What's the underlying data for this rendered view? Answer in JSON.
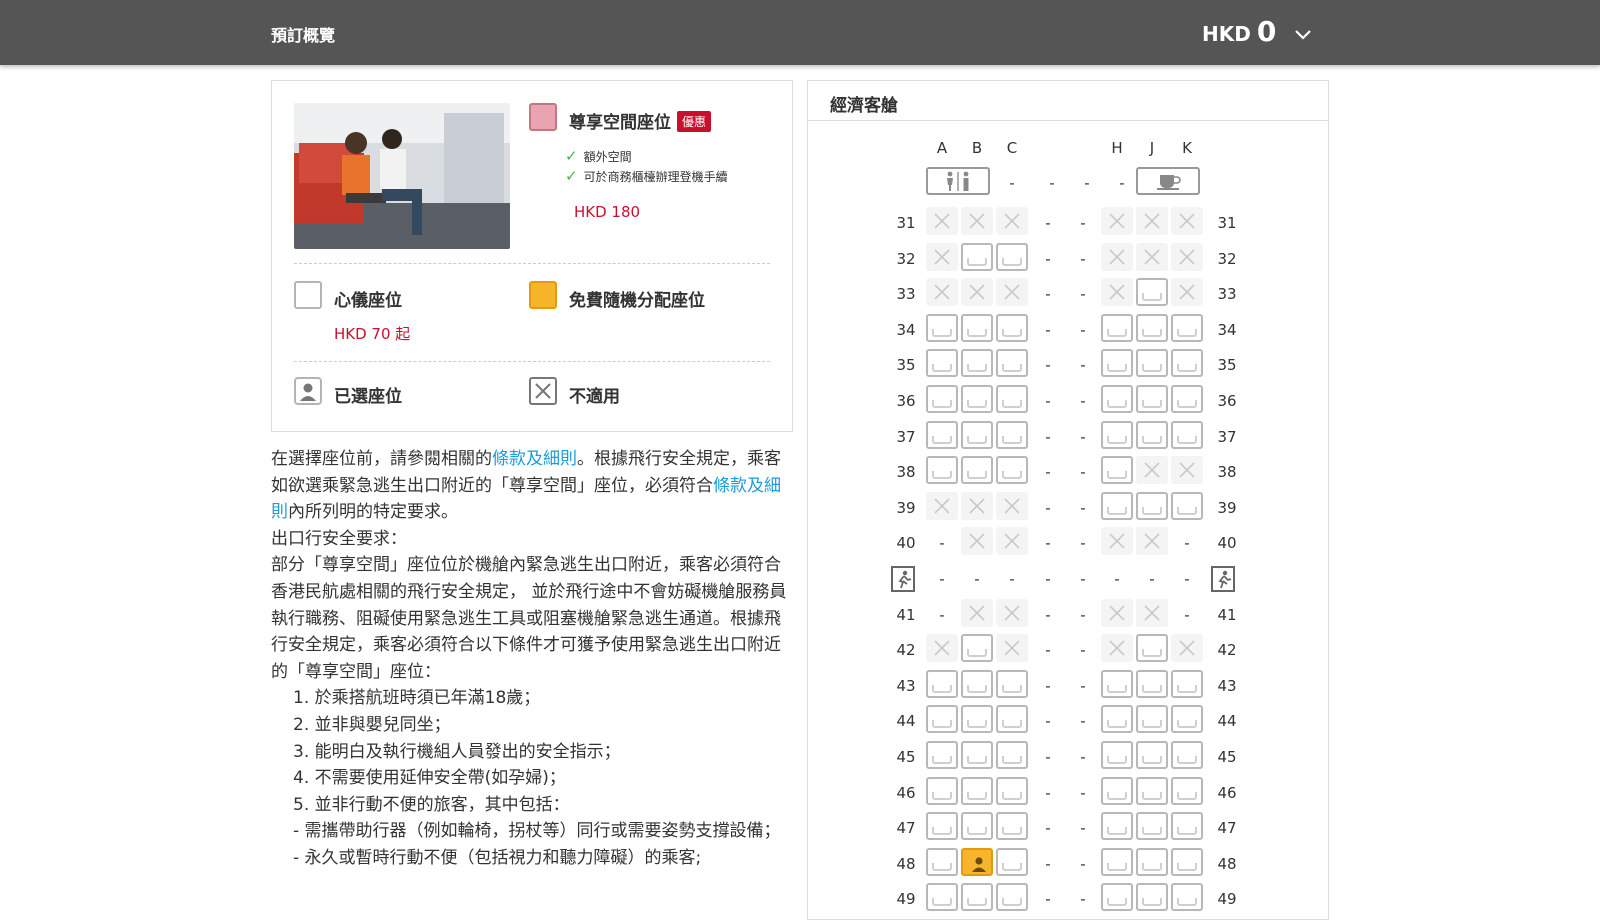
{
  "header": {
    "title": "預訂概覽",
    "currency": "HKD",
    "amount": "0"
  },
  "legend": {
    "premium": {
      "label": "尊享空間座位",
      "tag": "優惠",
      "features": [
        "額外空間",
        "可於商務櫃檯辦理登機手續"
      ],
      "price": "HKD 180"
    },
    "preferred": {
      "label": "心儀座位",
      "price": "HKD 70 起"
    },
    "free": {
      "label": "免費隨機分配座位"
    },
    "selected": {
      "label": "已選座位"
    },
    "unavailable": {
      "label": "不適用"
    }
  },
  "notice": {
    "p1_a": "在選擇座位前，請參閱相關的",
    "p1_link1": "條款及細則",
    "p1_b": "。根據飛行安全規定，乘客如欲選乘緊急逃生出口附近的「尊享空間」座位，必須符合",
    "p1_link2": "條款及細則",
    "p1_c": "內所列明的特定要求。",
    "heading": "出口行安全要求：",
    "p2": "部分「尊享空間」座位位於機艙內緊急逃生出口附近，乘客必須符合香港民航處相關的飛行安全規定， 並於飛行途中不會妨礙機艙服務員執行職務、阻礙使用緊急逃生工具或阻塞機艙緊急逃生通道。根據飛行安全規定，乘客必須符合以下條件才可獲予使用緊急逃生出口附近的「尊享空間」座位：",
    "items": [
      "1. 於乘搭航班時須已年滿18歲；",
      "2. 並非與嬰兒同坐；",
      "3. 能明白及執行機組人員發出的安全指示；",
      "4. 不需要使用延伸安全帶(如孕婦)；",
      "5. 並非行動不便的旅客，其中包括：",
      "- 需攜帶助行器（例如輪椅，拐杖等）同行或需要姿勢支撐設備；",
      "- 永久或暫時行動不便（包括視力和聽力障礙）的乘客;"
    ]
  },
  "cabin": {
    "title": "經濟客艙",
    "columns": [
      "A",
      "B",
      "C",
      "H",
      "J",
      "K"
    ],
    "aisle_mark": "-",
    "facilities": [
      "lavatory-icon",
      "galley-icon"
    ],
    "rows": [
      {
        "n": "31",
        "s": [
          "x",
          "x",
          "x",
          "x",
          "x",
          "x"
        ]
      },
      {
        "n": "32",
        "s": [
          "x",
          "o",
          "o",
          "x",
          "x",
          "x"
        ]
      },
      {
        "n": "33",
        "s": [
          "x",
          "x",
          "x",
          "x",
          "o",
          "x"
        ]
      },
      {
        "n": "34",
        "s": [
          "o",
          "o",
          "o",
          "o",
          "o",
          "o"
        ]
      },
      {
        "n": "35",
        "s": [
          "o",
          "o",
          "o",
          "o",
          "o",
          "o"
        ]
      },
      {
        "n": "36",
        "s": [
          "o",
          "o",
          "o",
          "o",
          "o",
          "o"
        ]
      },
      {
        "n": "37",
        "s": [
          "o",
          "o",
          "o",
          "o",
          "o",
          "o"
        ]
      },
      {
        "n": "38",
        "s": [
          "o",
          "o",
          "o",
          "o",
          "x",
          "x"
        ]
      },
      {
        "n": "39",
        "s": [
          "x",
          "x",
          "x",
          "o",
          "o",
          "o"
        ]
      },
      {
        "n": "40",
        "s": [
          "-",
          "x",
          "x",
          "x",
          "x",
          "-"
        ]
      },
      {
        "n": "exit"
      },
      {
        "n": "41",
        "s": [
          "-",
          "x",
          "x",
          "x",
          "x",
          "-"
        ]
      },
      {
        "n": "42",
        "s": [
          "x",
          "o",
          "x",
          "x",
          "o",
          "x"
        ]
      },
      {
        "n": "43",
        "s": [
          "o",
          "o",
          "o",
          "o",
          "o",
          "o"
        ]
      },
      {
        "n": "44",
        "s": [
          "o",
          "o",
          "o",
          "o",
          "o",
          "o"
        ]
      },
      {
        "n": "45",
        "s": [
          "o",
          "o",
          "o",
          "o",
          "o",
          "o"
        ]
      },
      {
        "n": "46",
        "s": [
          "o",
          "o",
          "o",
          "o",
          "o",
          "o"
        ]
      },
      {
        "n": "47",
        "s": [
          "o",
          "o",
          "o",
          "o",
          "o",
          "o"
        ]
      },
      {
        "n": "48",
        "s": [
          "o",
          "sel",
          "o",
          "o",
          "o",
          "o"
        ]
      },
      {
        "n": "49",
        "s": [
          "o",
          "o",
          "o",
          "o",
          "o",
          "o"
        ]
      }
    ]
  },
  "colors": {
    "header_bg": "#555555",
    "accent_red": "#c8102e",
    "link_blue": "#1a9cd8",
    "free_orange": "#f7b52c",
    "premium_pink": "#e8a4b0"
  }
}
